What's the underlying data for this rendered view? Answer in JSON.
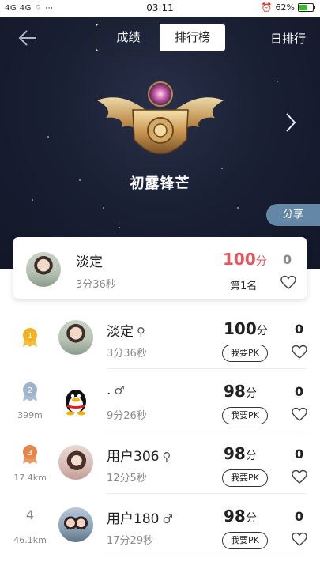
{
  "status_bar": {
    "left": "4G 4G ⌔ ⋯",
    "time": "03:11",
    "battery_pct": "62%",
    "battery_level": 0.62
  },
  "header": {
    "tabs": [
      {
        "label": "成绩",
        "active": true
      },
      {
        "label": "排行榜",
        "active": false
      }
    ],
    "day_rank": "日排行",
    "rank_title": "初露锋芒",
    "share": "分享"
  },
  "my_card": {
    "name": "淡定",
    "time": "3分36秒",
    "score": "100分",
    "rank": "第1名",
    "likes": "0",
    "score_color": "#e8555b"
  },
  "list": [
    {
      "rank": "1",
      "distance": "",
      "name": "淡定",
      "gender": "⚲",
      "time": "3分36秒",
      "score": "100",
      "unit": "分",
      "pk": "我要PK",
      "likes": "0",
      "medal_color": "#f0b323",
      "avatar": "woman"
    },
    {
      "rank": "2",
      "distance": "399m",
      "name": ".",
      "gender": "♂",
      "time": "9分26秒",
      "score": "98",
      "unit": "分",
      "pk": "我要PK",
      "likes": "0",
      "medal_color": "#9fb3cc",
      "avatar": "qq"
    },
    {
      "rank": "3",
      "distance": "17.4km",
      "name": "用户306",
      "gender": "⚲",
      "time": "12分5秒",
      "score": "98",
      "unit": "分",
      "pk": "我要PK",
      "likes": "0",
      "medal_color": "#e3884a",
      "avatar": "girl"
    },
    {
      "rank": "4",
      "distance": "46.1km",
      "name": "用户180",
      "gender": "♂",
      "time": "17分29秒",
      "score": "98",
      "unit": "分",
      "pk": "我要PK",
      "likes": "0",
      "medal_color": "",
      "avatar": "couple"
    }
  ]
}
